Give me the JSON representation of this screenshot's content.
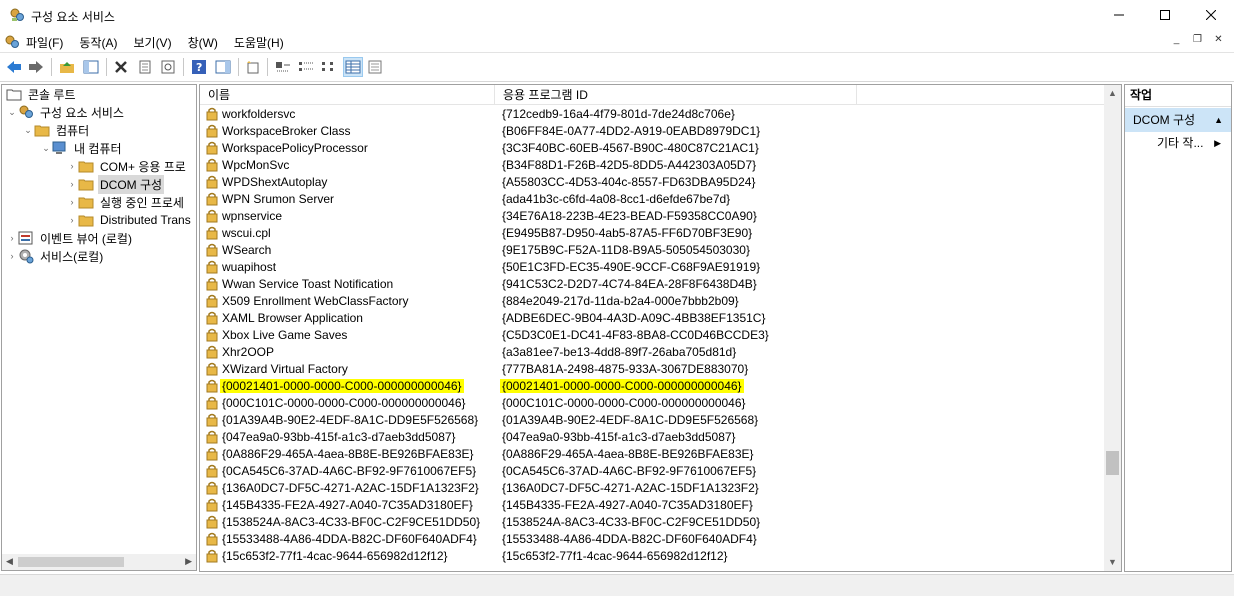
{
  "window": {
    "title": "구성 요소 서비스"
  },
  "menu": [
    "파일(F)",
    "동작(A)",
    "보기(V)",
    "창(W)",
    "도움말(H)"
  ],
  "tree": {
    "items": [
      {
        "label": "콘솔 루트",
        "icon": "folder-icon"
      },
      {
        "label": "구성 요소 서비스",
        "icon": "component-services-icon"
      },
      {
        "label": "컴퓨터",
        "icon": "folder-icon"
      },
      {
        "label": "내 컴퓨터",
        "icon": "computer-icon"
      },
      {
        "label": "COM+ 응용 프로",
        "icon": "folder-icon"
      },
      {
        "label": "DCOM 구성",
        "icon": "folder-icon"
      },
      {
        "label": "실행 중인 프로세",
        "icon": "folder-icon"
      },
      {
        "label": "Distributed Trans",
        "icon": "folder-icon"
      },
      {
        "label": "이벤트 뷰어 (로컬)",
        "icon": "event-viewer-icon"
      },
      {
        "label": "서비스(로컬)",
        "icon": "services-icon"
      }
    ]
  },
  "list": {
    "columns": [
      "이름",
      "응용 프로그램 ID"
    ],
    "rows": [
      [
        "workfoldersvc",
        "{712cedb9-16a4-4f79-801d-7de24d8c706e}"
      ],
      [
        "WorkspaceBroker Class",
        "{B06FF84E-0A77-4DD2-A919-0EABD8979DC1}"
      ],
      [
        "WorkspacePolicyProcessor",
        "{3C3F40BC-60EB-4567-B90C-480C87C21AC1}"
      ],
      [
        "WpcMonSvc",
        "{B34F88D1-F26B-42D5-8DD5-A442303A05D7}"
      ],
      [
        "WPDShextAutoplay",
        "{A55803CC-4D53-404c-8557-FD63DBA95D24}"
      ],
      [
        "WPN Srumon Server",
        "{ada41b3c-c6fd-4a08-8cc1-d6efde67be7d}"
      ],
      [
        "wpnservice",
        "{34E76A18-223B-4E23-BEAD-F59358CC0A90}"
      ],
      [
        "wscui.cpl",
        "{E9495B87-D950-4ab5-87A5-FF6D70BF3E90}"
      ],
      [
        "WSearch",
        "{9E175B9C-F52A-11D8-B9A5-505054503030}"
      ],
      [
        "wuapihost",
        "{50E1C3FD-EC35-490E-9CCF-C68F9AE91919}"
      ],
      [
        "Wwan Service Toast Notification",
        "{941C53C2-D2D7-4C74-84EA-28F8F6438D4B}"
      ],
      [
        "X509 Enrollment WebClassFactory",
        "{884e2049-217d-11da-b2a4-000e7bbb2b09}"
      ],
      [
        "XAML Browser Application",
        "{ADBE6DEC-9B04-4A3D-A09C-4BB38EF1351C}"
      ],
      [
        "Xbox Live Game Saves",
        "{C5D3C0E1-DC41-4F83-8BA8-CC0D46BCCDE3}"
      ],
      [
        "Xhr2OOP",
        "{a3a81ee7-be13-4dd8-89f7-26aba705d81d}"
      ],
      [
        "XWizard Virtual Factory",
        "{777BA81A-2498-4875-933A-3067DE883070}"
      ],
      [
        "{00021401-0000-0000-C000-000000000046}",
        "{00021401-0000-0000-C000-000000000046}"
      ],
      [
        "{000C101C-0000-0000-C000-000000000046}",
        "{000C101C-0000-0000-C000-000000000046}"
      ],
      [
        "{01A39A4B-90E2-4EDF-8A1C-DD9E5F526568}",
        "{01A39A4B-90E2-4EDF-8A1C-DD9E5F526568}"
      ],
      [
        "{047ea9a0-93bb-415f-a1c3-d7aeb3dd5087}",
        "{047ea9a0-93bb-415f-a1c3-d7aeb3dd5087}"
      ],
      [
        "{0A886F29-465A-4aea-8B8E-BE926BFAE83E}",
        "{0A886F29-465A-4aea-8B8E-BE926BFAE83E}"
      ],
      [
        "{0CA545C6-37AD-4A6C-BF92-9F7610067EF5}",
        "{0CA545C6-37AD-4A6C-BF92-9F7610067EF5}"
      ],
      [
        "{136A0DC7-DF5C-4271-A2AC-15DF1A1323F2}",
        "{136A0DC7-DF5C-4271-A2AC-15DF1A1323F2}"
      ],
      [
        "{145B4335-FE2A-4927-A040-7C35AD3180EF}",
        "{145B4335-FE2A-4927-A040-7C35AD3180EF}"
      ],
      [
        "{1538524A-8AC3-4C33-BF0C-C2F9CE51DD50}",
        "{1538524A-8AC3-4C33-BF0C-C2F9CE51DD50}"
      ],
      [
        "{15533488-4A86-4DDA-B82C-DF60F640ADF4}",
        "{15533488-4A86-4DDA-B82C-DF60F640ADF4}"
      ],
      [
        "{15c653f2-77f1-4cac-9644-656982d12f12}",
        "{15c653f2-77f1-4cac-9644-656982d12f12}"
      ]
    ],
    "highlighted_row_index": 16,
    "highlight_color": "#ffff00"
  },
  "actions": {
    "header": "작업",
    "section": "DCOM 구성",
    "items": [
      "기타 작..."
    ]
  },
  "colors": {
    "selection": "#cce4f7",
    "folder": "#e8b847"
  }
}
